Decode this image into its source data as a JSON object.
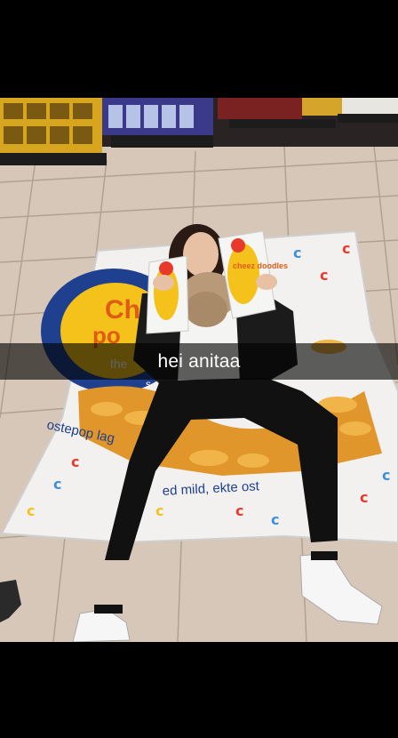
{
  "snap": {
    "caption": "hei anitaa"
  },
  "photo": {
    "bag_print": {
      "brand_fragment": "Ch",
      "brand_fragment_2": "po",
      "line_the": "the",
      "line_side": "s",
      "text_left": "ostepop lag",
      "text_bottom": "ed mild, ekte ost"
    },
    "snack_bag_label": "cheez doodles"
  },
  "colors": {
    "caption_bg": "#000000",
    "caption_text": "#ffffff",
    "bag_blue": "#1f3f8f",
    "bag_yellow": "#f4c21a",
    "snack_orange": "#e0962a"
  }
}
